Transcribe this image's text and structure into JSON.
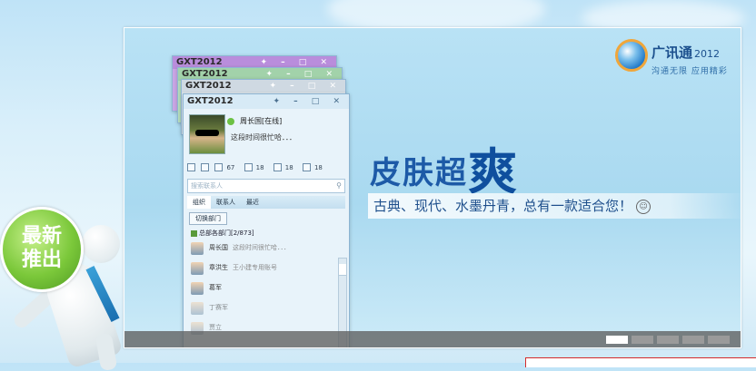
{
  "brand": {
    "name": "广讯通",
    "year": "2012",
    "slogan": "沟通无限  应用精彩"
  },
  "banner": {
    "headline_prefix": "皮肤超",
    "headline_emphasis": "爽",
    "subline": "古典、现代、水墨丹青，总有一款适合您！",
    "smile_icon": "☺"
  },
  "windows": {
    "w1_title": "GXT2012",
    "w2_title": "GXT2012",
    "w3_title": "GXT2012",
    "main_title": "GXT2012",
    "controls": "✦ – □ ✕"
  },
  "profile": {
    "name": "周长国[在线]",
    "status_msg": "这段时间很忙哈．．．"
  },
  "counters": [
    "67",
    "18",
    "18",
    "18"
  ],
  "search": {
    "placeholder": "搜索联系人"
  },
  "tabs": [
    "组织",
    "联系人",
    "最近"
  ],
  "switch_button": "切换部门",
  "group": {
    "label": "总部各部门[2/873]"
  },
  "contacts": [
    {
      "name": "周长国",
      "status": "这段时间很忙哈．．．"
    },
    {
      "name": "章洪生",
      "status": "王小建专用账号"
    },
    {
      "name": "葛军",
      "status": ""
    },
    {
      "name": "丁赛军",
      "status": ""
    },
    {
      "name": "贾立",
      "status": ""
    }
  ],
  "badge": {
    "line1": "最新",
    "line2": "推出"
  },
  "colors": {
    "accent": "#1d5aa7",
    "badge": "#7bc83a",
    "carousel_active": "#ffffff"
  }
}
